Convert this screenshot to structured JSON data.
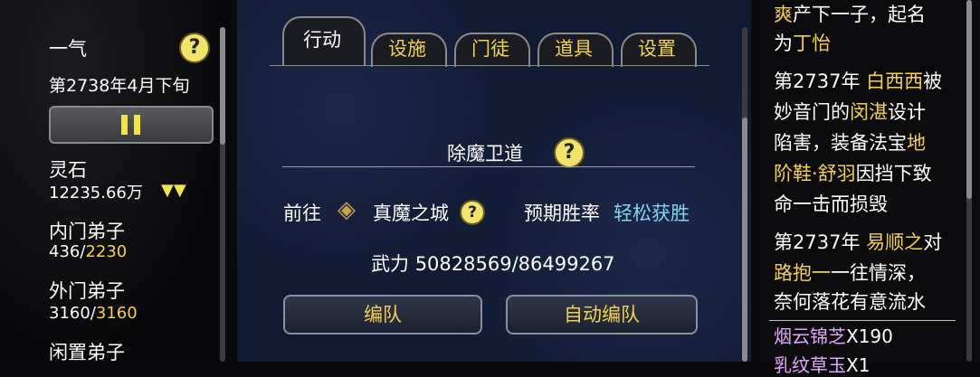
{
  "sect_name": "一气",
  "date": "第2738年4月下旬",
  "resources": {
    "spirit_stone_label": "灵石",
    "spirit_stone_value": "12235.66万",
    "inner_label": "内门弟子",
    "inner_current": "436",
    "inner_max": "2230",
    "outer_label": "外门弟子",
    "outer_current": "3160",
    "outer_max": "3160",
    "idle_label": "闲置弟子"
  },
  "tabs": [
    "行动",
    "设施",
    "门徒",
    "道具",
    "设置"
  ],
  "mission": {
    "title": "除魔卫道",
    "go_label": "前往",
    "destination": "真魔之城",
    "win_rate_label": "预期胜率",
    "win_rate_value": "轻松获胜",
    "power_label": "武力",
    "power_value": "50828569/86499267",
    "form_team_label": "编队",
    "auto_form_label": "自动编队"
  },
  "log": [
    {
      "segments": [
        {
          "t": "爽",
          "c": "y"
        },
        {
          "t": "产下一子，起名",
          "c": "w"
        }
      ]
    },
    {
      "segments": [
        {
          "t": "为",
          "c": "w"
        },
        {
          "t": "丁怡",
          "c": "y"
        }
      ]
    },
    {
      "segments": [
        {
          "t": "第2737年 ",
          "c": "w"
        },
        {
          "t": "白西西",
          "c": "y"
        },
        {
          "t": "被",
          "c": "w"
        }
      ]
    },
    {
      "segments": [
        {
          "t": "妙音门的",
          "c": "w"
        },
        {
          "t": "闵湛",
          "c": "y"
        },
        {
          "t": "设计",
          "c": "w"
        }
      ]
    },
    {
      "segments": [
        {
          "t": "陷害，装备法宝",
          "c": "w"
        },
        {
          "t": "地",
          "c": "y"
        }
      ]
    },
    {
      "segments": [
        {
          "t": "阶鞋·舒羽",
          "c": "y"
        },
        {
          "t": "因挡下致",
          "c": "w"
        }
      ]
    },
    {
      "segments": [
        {
          "t": "命一击而损毁",
          "c": "w"
        }
      ]
    },
    {
      "segments": [
        {
          "t": "第2737年 ",
          "c": "w"
        },
        {
          "t": "易顺之",
          "c": "y"
        },
        {
          "t": "对",
          "c": "w"
        }
      ]
    },
    {
      "segments": [
        {
          "t": "路抱一",
          "c": "y"
        },
        {
          "t": "一往情深，",
          "c": "w"
        }
      ]
    },
    {
      "segments": [
        {
          "t": "奈何落花有意流水",
          "c": "w"
        }
      ]
    }
  ],
  "item_list": [
    {
      "name": "烟云锦芝",
      "count": "X190"
    },
    {
      "name": "乳纹草玉",
      "count": "X1"
    }
  ]
}
